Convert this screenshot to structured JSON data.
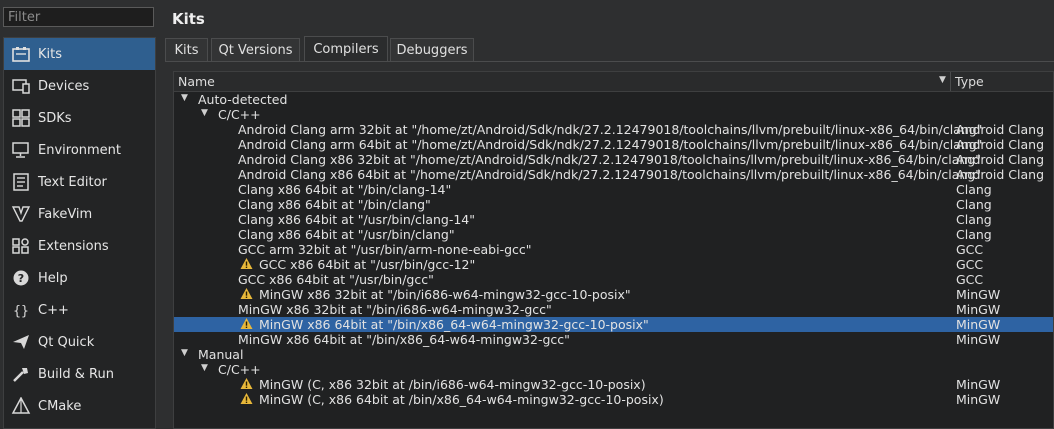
{
  "filter": {
    "placeholder": "Filter"
  },
  "sidebar": {
    "items": [
      {
        "label": "Kits",
        "icon": "kits-icon",
        "active": true
      },
      {
        "label": "Devices",
        "icon": "devices-icon"
      },
      {
        "label": "SDKs",
        "icon": "sdks-icon"
      },
      {
        "label": "Environment",
        "icon": "environment-icon"
      },
      {
        "label": "Text Editor",
        "icon": "text-editor-icon"
      },
      {
        "label": "FakeVim",
        "icon": "fakevim-icon"
      },
      {
        "label": "Extensions",
        "icon": "extensions-icon"
      },
      {
        "label": "Help",
        "icon": "help-icon"
      },
      {
        "label": "C++",
        "icon": "cpp-icon"
      },
      {
        "label": "Qt Quick",
        "icon": "qt-quick-icon"
      },
      {
        "label": "Build & Run",
        "icon": "build-run-icon"
      },
      {
        "label": "CMake",
        "icon": "cmake-icon"
      }
    ]
  },
  "page": {
    "title": "Kits"
  },
  "tabs": [
    {
      "label": "Kits"
    },
    {
      "label": "Qt Versions"
    },
    {
      "label": "Compilers",
      "active": true
    },
    {
      "label": "Debuggers"
    }
  ],
  "tree": {
    "columns": {
      "name": "Name",
      "type": "Type"
    },
    "groups": [
      {
        "label": "Auto-detected",
        "sublabel": "C/C++",
        "rows": [
          {
            "name": "Android Clang arm 32bit at \"/home/zt/Android/Sdk/ndk/27.2.12479018/toolchains/llvm/prebuilt/linux-x86_64/bin/clang\"",
            "type": "Android Clang"
          },
          {
            "name": "Android Clang arm 64bit at \"/home/zt/Android/Sdk/ndk/27.2.12479018/toolchains/llvm/prebuilt/linux-x86_64/bin/clang\"",
            "type": "Android Clang"
          },
          {
            "name": "Android Clang x86 32bit at \"/home/zt/Android/Sdk/ndk/27.2.12479018/toolchains/llvm/prebuilt/linux-x86_64/bin/clang\"",
            "type": "Android Clang"
          },
          {
            "name": "Android Clang x86 64bit at \"/home/zt/Android/Sdk/ndk/27.2.12479018/toolchains/llvm/prebuilt/linux-x86_64/bin/clang\"",
            "type": "Android Clang"
          },
          {
            "name": "Clang x86 64bit at \"/bin/clang-14\"",
            "type": "Clang"
          },
          {
            "name": "Clang x86 64bit at \"/bin/clang\"",
            "type": "Clang"
          },
          {
            "name": "Clang x86 64bit at \"/usr/bin/clang-14\"",
            "type": "Clang"
          },
          {
            "name": "Clang x86 64bit at \"/usr/bin/clang\"",
            "type": "Clang"
          },
          {
            "name": "GCC arm 32bit at \"/usr/bin/arm-none-eabi-gcc\"",
            "type": "GCC"
          },
          {
            "name": "GCC x86 64bit at \"/usr/bin/gcc-12\"",
            "type": "GCC",
            "warning": true
          },
          {
            "name": "GCC x86 64bit at \"/usr/bin/gcc\"",
            "type": "GCC"
          },
          {
            "name": "MinGW x86 32bit at \"/bin/i686-w64-mingw32-gcc-10-posix\"",
            "type": "MinGW",
            "warning": true
          },
          {
            "name": "MinGW x86 32bit at \"/bin/i686-w64-mingw32-gcc\"",
            "type": "MinGW"
          },
          {
            "name": "MinGW x86 64bit at \"/bin/x86_64-w64-mingw32-gcc-10-posix\"",
            "type": "MinGW",
            "warning": true,
            "selected": true
          },
          {
            "name": "MinGW x86 64bit at \"/bin/x86_64-w64-mingw32-gcc\"",
            "type": "MinGW"
          }
        ]
      },
      {
        "label": "Manual",
        "sublabel": "C/C++",
        "rows": [
          {
            "name": "MinGW (C, x86 32bit at /bin/i686-w64-mingw32-gcc-10-posix)",
            "type": "MinGW",
            "warning": true
          },
          {
            "name": "MinGW (C, x86 64bit at /bin/x86_64-w64-mingw32-gcc-10-posix)",
            "type": "MinGW",
            "warning": true
          }
        ]
      }
    ]
  },
  "colors": {
    "selection": "#2e63a3",
    "sidebar_active": "#2f5f8f",
    "warning": "#e8b83a"
  }
}
